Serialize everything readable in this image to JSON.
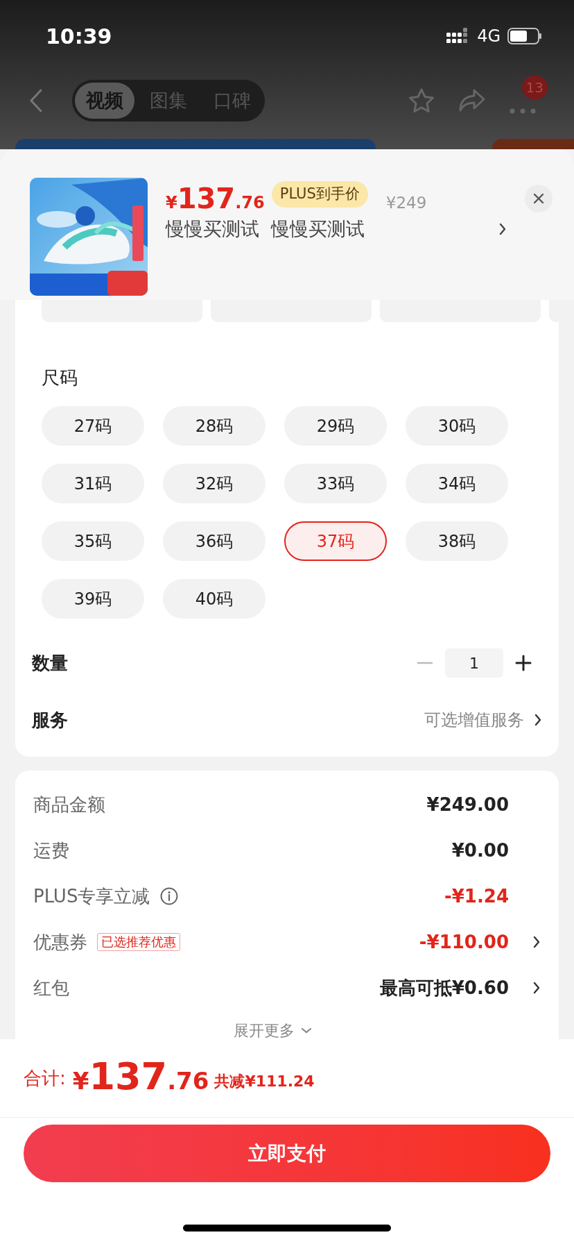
{
  "status_bar": {
    "time": "10:39",
    "network": "4G"
  },
  "nav": {
    "tabs": [
      {
        "label": "视频",
        "selected": true
      },
      {
        "label": "图集",
        "selected": false
      },
      {
        "label": "口碑",
        "selected": false
      }
    ],
    "badge": "13"
  },
  "product": {
    "currency": "¥",
    "price_int": "137",
    "price_dec": ".76",
    "tag": "PLUS到手价",
    "original_price": "¥249",
    "title": "慢慢买测试  慢慢买测试"
  },
  "size": {
    "label": "尺码",
    "options": [
      {
        "label": "27码",
        "selected": false
      },
      {
        "label": "28码",
        "selected": false
      },
      {
        "label": "29码",
        "selected": false
      },
      {
        "label": "30码",
        "selected": false
      },
      {
        "label": "31码",
        "selected": false
      },
      {
        "label": "32码",
        "selected": false
      },
      {
        "label": "33码",
        "selected": false
      },
      {
        "label": "34码",
        "selected": false
      },
      {
        "label": "35码",
        "selected": false
      },
      {
        "label": "36码",
        "selected": false
      },
      {
        "label": "37码",
        "selected": true
      },
      {
        "label": "38码",
        "selected": false
      },
      {
        "label": "39码",
        "selected": false
      },
      {
        "label": "40码",
        "selected": false
      }
    ]
  },
  "quantity": {
    "label": "数量",
    "value": "1",
    "decrement_disabled": true
  },
  "service": {
    "label": "服务",
    "value": "可选增值服务"
  },
  "summary": [
    {
      "label": "商品金额",
      "value": "¥249.00",
      "red": false,
      "chevron": false,
      "info": false
    },
    {
      "label": "运费",
      "value": "¥0.00",
      "red": false,
      "chevron": false,
      "info": false
    },
    {
      "label": "PLUS专享立减",
      "value": "-¥1.24",
      "red": true,
      "chevron": false,
      "info": true
    },
    {
      "label": "优惠券",
      "tag": "已选推荐优惠",
      "value": "-¥110.00",
      "red": true,
      "chevron": true,
      "info": false
    },
    {
      "label": "红包",
      "value": "最高可抵¥0.60",
      "red": false,
      "chevron": true,
      "info": false
    }
  ],
  "expand": "展开更多",
  "footer": {
    "total_label": "合计:",
    "currency": "¥",
    "price_int": "137",
    "price_dec": ".76",
    "saved": "共减¥111.24",
    "pay_button": "立即支付"
  }
}
